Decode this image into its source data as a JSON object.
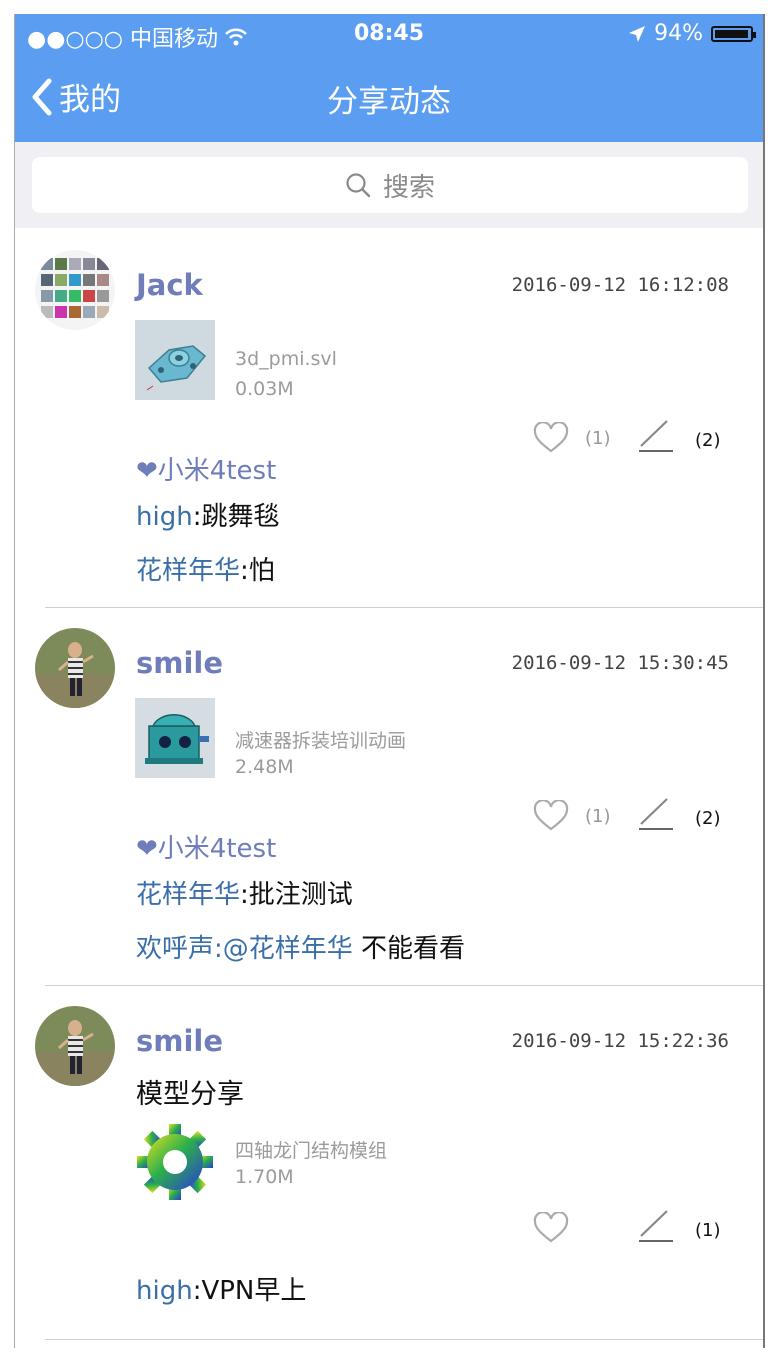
{
  "status_bar": {
    "carrier": "●●○○○ 中国移动",
    "time": "08:45",
    "battery": "94%"
  },
  "nav": {
    "back_label": "我的",
    "title": "分享动态"
  },
  "search": {
    "placeholder": "搜索"
  },
  "posts": [
    {
      "user": "Jack",
      "time": "2016-09-12 16:12:08",
      "file_name": "3d_pmi.svl",
      "file_size": "0.03M",
      "like_count": "(1)",
      "comment_count": "(2)",
      "liked_by": "❤小米4test",
      "comments": [
        {
          "name": "high",
          "sep": ":",
          "text": "跳舞毯"
        },
        {
          "name": "花样年华",
          "sep": ":",
          "text": "怕"
        }
      ]
    },
    {
      "user": "smile",
      "time": "2016-09-12 15:30:45",
      "file_name": "减速器拆装培训动画",
      "file_size": "2.48M",
      "like_count": "(1)",
      "comment_count": "(2)",
      "liked_by": "❤小米4test",
      "comments": [
        {
          "name": "花样年华",
          "sep": ":",
          "text": "批注测试"
        },
        {
          "name": "欢呼声",
          "sep": ":",
          "mention": "@花样年华",
          "text": " 不能看看"
        }
      ]
    },
    {
      "user": "smile",
      "time": "2016-09-12 15:22:36",
      "text": "模型分享",
      "file_name": "四轴龙门结构模组",
      "file_size": "1.70M",
      "comment_count": "(1)",
      "comments": [
        {
          "name": "high",
          "sep": ":",
          "text": "VPN早上"
        }
      ]
    }
  ],
  "colors": {
    "nav_bar": "#5a9df1",
    "username": "#6f7dba",
    "comment_name": "#3a6fa9"
  }
}
